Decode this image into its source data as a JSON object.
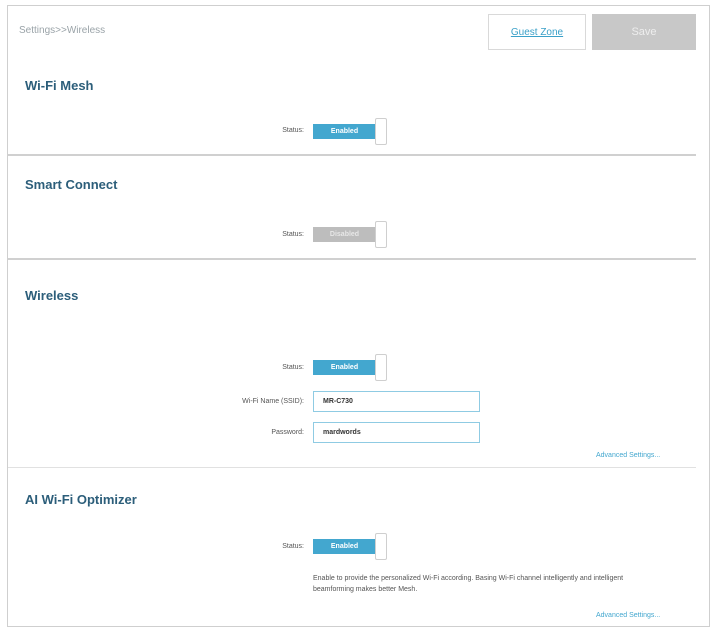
{
  "header": {
    "breadcrumb": "Settings>>Wireless",
    "guest_zone_label": "Guest Zone",
    "save_label": "Save"
  },
  "wifi_mesh": {
    "title": "Wi-Fi Mesh",
    "status_label": "Status:",
    "status_value": "Enabled",
    "enabled": true
  },
  "smart_connect": {
    "title": "Smart Connect",
    "status_label": "Status:",
    "status_value": "Disabled",
    "enabled": false
  },
  "wireless": {
    "title": "Wireless",
    "status_label": "Status:",
    "status_value": "Enabled",
    "enabled": true,
    "ssid_label": "Wi-Fi Name (SSID):",
    "ssid_value": "MR-C730",
    "password_label": "Password:",
    "password_value": "mardwords",
    "advanced_link": "Advanced Settings..."
  },
  "ai_optimizer": {
    "title": "AI Wi-Fi Optimizer",
    "status_label": "Status:",
    "status_value": "Enabled",
    "enabled": true,
    "description": "Enable to provide the personalized Wi-Fi according. Basing Wi-Fi channel intelligently and intelligent beamforming makes better Mesh.",
    "advanced_link": "Advanced Settings..."
  },
  "colors": {
    "accent": "#43a7cf",
    "title": "#2c5e7a",
    "disabled": "#bdbdbd"
  }
}
